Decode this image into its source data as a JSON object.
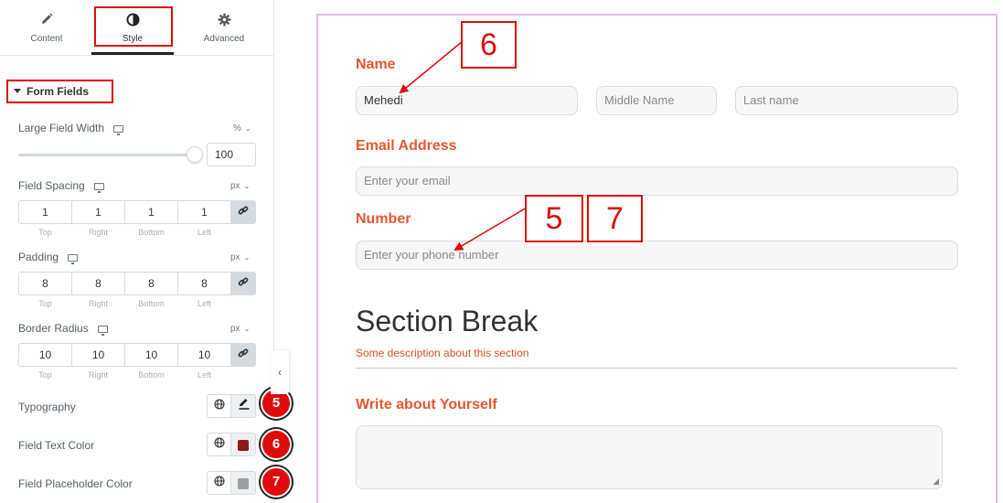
{
  "tabs": {
    "content": "Content",
    "style": "Style",
    "advanced": "Advanced"
  },
  "section": {
    "title": "Form Fields"
  },
  "controls": {
    "large_field_width": {
      "label": "Large Field Width",
      "unit": "%",
      "value": "100",
      "slider_percent": 100
    },
    "field_spacing": {
      "label": "Field Spacing",
      "unit": "px",
      "values": [
        "1",
        "1",
        "1",
        "1"
      ]
    },
    "padding": {
      "label": "Padding",
      "unit": "px",
      "values": [
        "8",
        "8",
        "8",
        "8"
      ]
    },
    "border_radius": {
      "label": "Border Radius",
      "unit": "px",
      "values": [
        "10",
        "10",
        "10",
        "10"
      ]
    },
    "dim_labels": [
      "Top",
      "Right",
      "Bottom",
      "Left"
    ],
    "typography": {
      "label": "Typography",
      "badge": "5"
    },
    "field_text_color": {
      "label": "Field Text Color",
      "badge": "6",
      "color": "#8b1a1a"
    },
    "field_placeholder_color": {
      "label": "Field Placeholder Color",
      "badge": "7",
      "color": "#9e9e9e"
    }
  },
  "form": {
    "name_label": "Name",
    "first_name_value": "Mehedi",
    "middle_name_placeholder": "Middle Name",
    "last_name_placeholder": "Last name",
    "email_label": "Email Address",
    "email_placeholder": "Enter your email",
    "number_label": "Number",
    "number_placeholder": "Enter your phone number",
    "section_title": "Section Break",
    "section_description": "Some description about this section",
    "about_label": "Write about Yourself"
  },
  "callouts": {
    "six": "6",
    "five": "5",
    "seven": "7"
  },
  "colors": {
    "accent_red": "#e00a0a",
    "label_orange": "#e5572c",
    "card_border": "#e9b8ea"
  }
}
